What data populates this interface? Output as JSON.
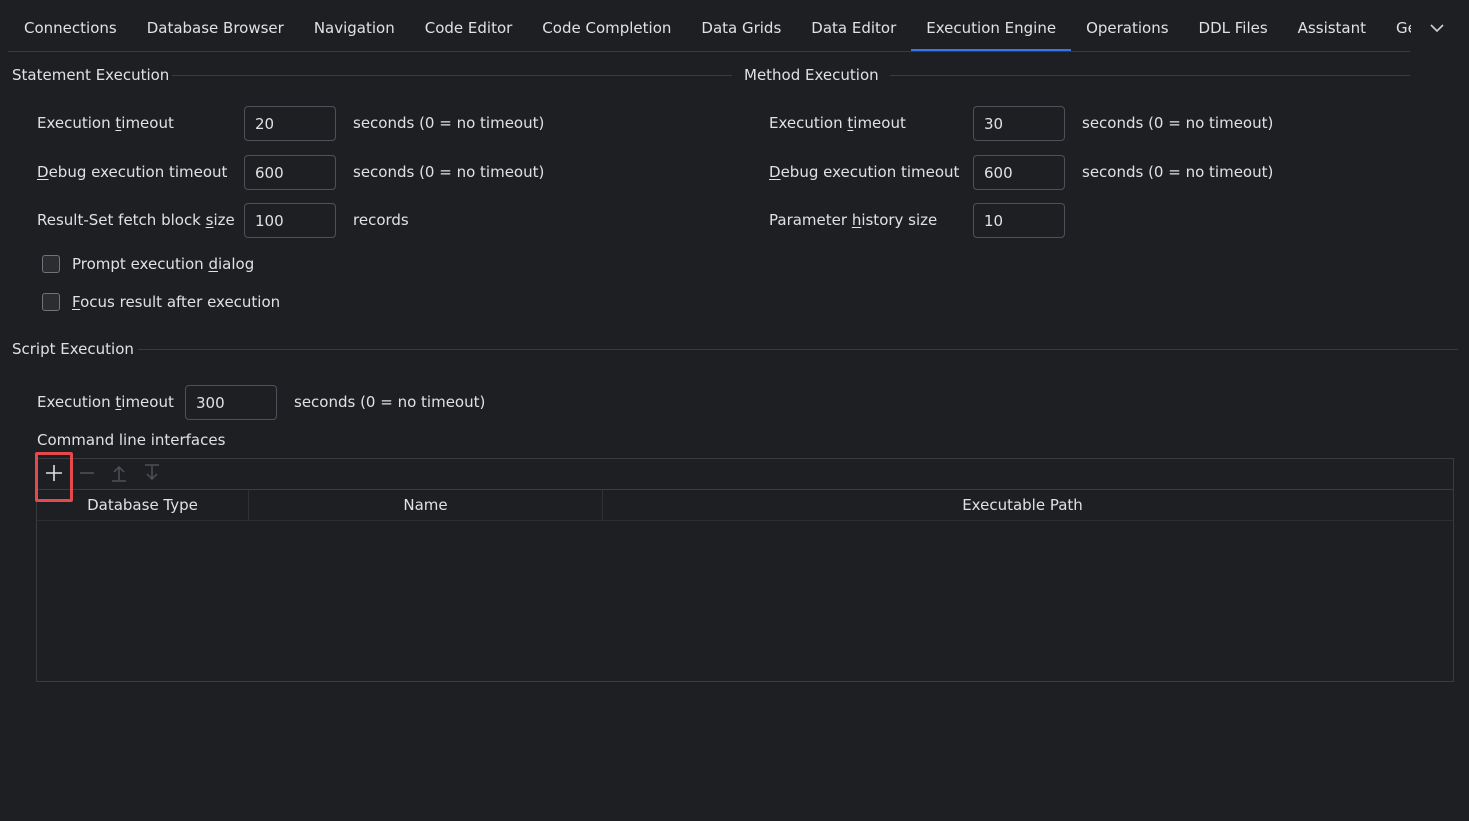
{
  "tabs": [
    {
      "label": "Connections",
      "active": false
    },
    {
      "label": "Database Browser",
      "active": false
    },
    {
      "label": "Navigation",
      "active": false
    },
    {
      "label": "Code Editor",
      "active": false
    },
    {
      "label": "Code Completion",
      "active": false
    },
    {
      "label": "Data Grids",
      "active": false
    },
    {
      "label": "Data Editor",
      "active": false
    },
    {
      "label": "Execution Engine",
      "active": true
    },
    {
      "label": "Operations",
      "active": false
    },
    {
      "label": "DDL Files",
      "active": false
    },
    {
      "label": "Assistant",
      "active": false
    },
    {
      "label": "General",
      "active": false
    }
  ],
  "tabs_overflow_icon": "chevron-down-icon",
  "statement": {
    "title": "Statement Execution",
    "exec_timeout": {
      "pre": "Execution ",
      "mn": "t",
      "post": "imeout",
      "value": "20",
      "unit": "seconds (0 = no timeout)"
    },
    "debug_timeout": {
      "pre": "",
      "mn": "D",
      "post": "ebug execution timeout",
      "value": "600",
      "unit": "seconds (0 = no timeout)"
    },
    "fetch_block": {
      "pre": "Result-Set fetch block ",
      "mn": "s",
      "post": "ize",
      "value": "100",
      "unit": "records"
    },
    "prompt_dialog": {
      "pre": "Prompt execution ",
      "mn": "d",
      "post": "ialog",
      "checked": false
    },
    "focus_result": {
      "pre": "",
      "mn": "F",
      "post": "ocus result after execution",
      "checked": false
    }
  },
  "method": {
    "title": "Method Execution",
    "exec_timeout": {
      "pre": "Execution ",
      "mn": "t",
      "post": "imeout",
      "value": "30",
      "unit": "seconds (0 = no timeout)"
    },
    "debug_timeout": {
      "pre": "",
      "mn": "D",
      "post": "ebug execution timeout",
      "value": "600",
      "unit": "seconds (0 = no timeout)"
    },
    "param_history": {
      "pre": "Parameter ",
      "mn": "h",
      "post": "istory size",
      "value": "10"
    }
  },
  "script": {
    "title": "Script Execution",
    "exec_timeout": {
      "pre": "Execution ",
      "mn": "t",
      "post": "imeout",
      "value": "300",
      "unit": "seconds (0 = no timeout)"
    },
    "cli_label": "Command line interfaces",
    "toolbar": {
      "add_icon": "plus-icon",
      "remove_icon": "minus-icon",
      "move_up_icon": "arrow-up-icon",
      "move_down_icon": "arrow-down-icon"
    },
    "columns": [
      "Database Type",
      "Name",
      "Executable Path"
    ],
    "rows": []
  },
  "colors": {
    "background": "#1e1f22",
    "accent": "#3574f0",
    "highlight": "#e5484d",
    "border": "#4e5157"
  }
}
